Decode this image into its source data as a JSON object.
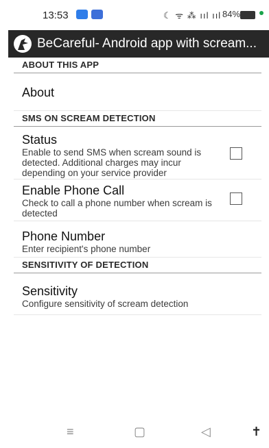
{
  "statusbar": {
    "time": "13:53",
    "icons_text": "☾ ᯤ ⁂ ııl ııl",
    "battery": "84%"
  },
  "appbar": {
    "title": "BeCareful- Android app with scream..."
  },
  "sections": {
    "about": {
      "header": "ABOUT THIS APP",
      "about_title": "About"
    },
    "sms": {
      "header": "SMS ON SCREAM DETECTION",
      "status_title": "Status",
      "status_summary": "Enable to send SMS when scream sound is detected. Additional charges may incur depending on your service provider",
      "status_checked": false,
      "call_title": "Enable Phone Call",
      "call_summary": "Check to call a phone number when scream is detected",
      "call_checked": false,
      "phone_title": "Phone Number",
      "phone_summary": "Enter recipient's phone number"
    },
    "sensitivity": {
      "header": "SENSITIVITY OF DETECTION",
      "title": "Sensitivity",
      "summary": "Configure sensitivity of scream detection"
    }
  },
  "navbar": {
    "menu_glyph": "≡",
    "home_glyph": "▢",
    "back_glyph": "◁",
    "accessibility_glyph": "✝"
  }
}
